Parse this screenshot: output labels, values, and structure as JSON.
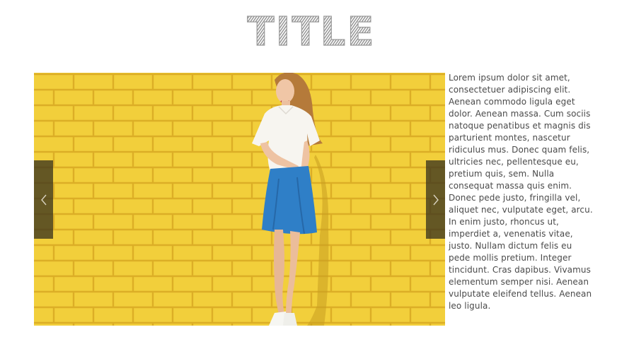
{
  "page": {
    "title": "TITLE",
    "paragraph": "Lorem ipsum dolor sit amet,\nconsectetuer adipiscing elit.\nAenean commodo ligula eget\ndolor. Aenean massa. Cum sociis\nnatoque penatibus et magnis dis\nparturient montes, nascetur\nridiculus mus. Donec quam felis,\nultricies nec, pellentesque eu,\npretium quis, sem. Nulla\nconsequat massa quis enim.\nDonec pede justo, fringilla vel,\naliquet nec, vulputate eget, arcu.\nIn enim justo, rhoncus ut,\nimperdiet a, venenatis vitae,\njusto. Nullam dictum felis eu\npede mollis pretium. Integer\ntincidunt. Cras dapibus. Vivamus\nelementum semper nisi. Aenean\nvulputate eleifend tellus. Aenean\nleo ligula."
  },
  "gallery": {
    "prev_icon": "chevron-left-icon",
    "next_icon": "chevron-right-icon"
  },
  "colors": {
    "wall": "#f2cf3b",
    "mortar": "#e3b52a",
    "title": "#8a8a8a",
    "arrow_bg": "#3c341e",
    "text": "#4a4a4a"
  }
}
